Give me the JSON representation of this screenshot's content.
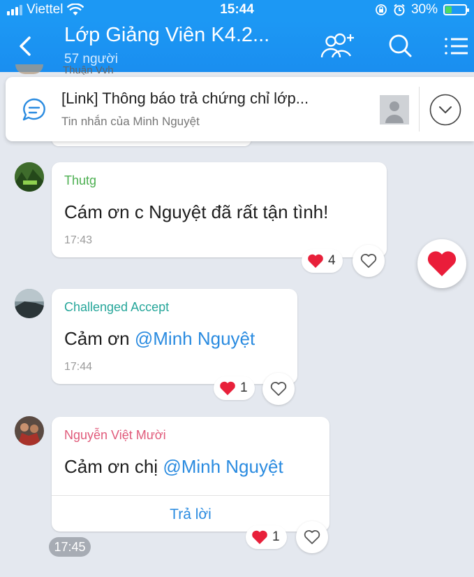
{
  "status_bar": {
    "carrier": "Viettel",
    "time": "15:44",
    "battery": "30%"
  },
  "header": {
    "title": "Lớp Giảng Viên K4.2...",
    "subtitle": "57 người"
  },
  "pinned": {
    "title": "[Link] Thông báo trả chứng chỉ lớp...",
    "subtitle": "Tin nhắn của Minh Nguyệt"
  },
  "partial_sender": "Thuận Vvh",
  "messages": [
    {
      "sender": "Thutg",
      "sender_color": "#4caf50",
      "text": "Cám ơn c Nguyệt đã rất tận tình!",
      "time": "17:43",
      "reaction_count": "4"
    },
    {
      "sender": "Challenged Accept",
      "sender_color": "#26a69a",
      "text_prefix": "Cảm ơn ",
      "mention": "@Minh Nguyệt",
      "time": "17:44",
      "reaction_count": "1"
    },
    {
      "sender": "Nguyễn Việt Mười",
      "sender_color": "#e05a7a",
      "text_prefix": "Cảm ơn chị ",
      "mention": "@Minh Nguyệt",
      "reply_label": "Trả lời",
      "reaction_count": "1"
    }
  ],
  "time_chip": "17:45",
  "colors": {
    "header_blue": "#1c98f4",
    "mention_blue": "#2a8be0",
    "heart_red": "#e8203a",
    "background": "#e4e8ef"
  }
}
